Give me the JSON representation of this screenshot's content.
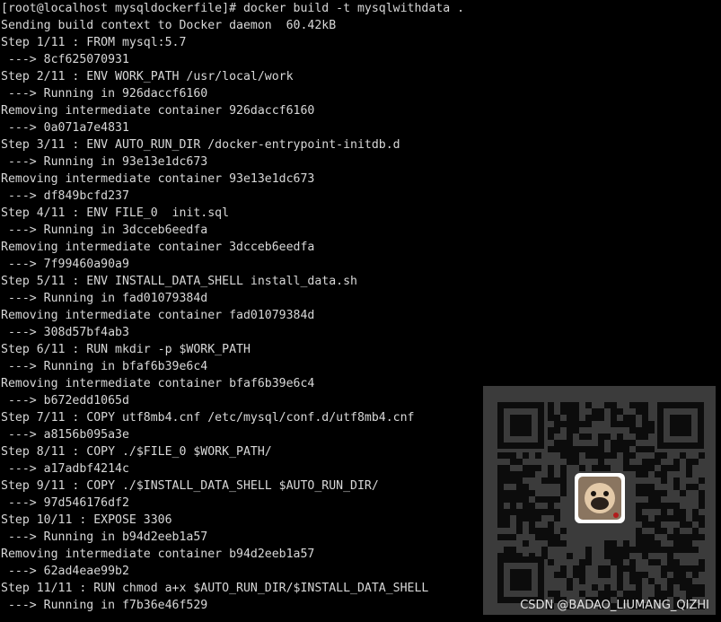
{
  "terminal": {
    "lines": [
      "[root@localhost mysqldockerfile]# docker build -t mysqlwithdata .",
      "Sending build context to Docker daemon  60.42kB",
      "Step 1/11 : FROM mysql:5.7",
      " ---> 8cf625070931",
      "Step 2/11 : ENV WORK_PATH /usr/local/work",
      " ---> Running in 926daccf6160",
      "Removing intermediate container 926daccf6160",
      " ---> 0a071a7e4831",
      "Step 3/11 : ENV AUTO_RUN_DIR /docker-entrypoint-initdb.d",
      " ---> Running in 93e13e1dc673",
      "Removing intermediate container 93e13e1dc673",
      " ---> df849bcfd237",
      "Step 4/11 : ENV FILE_0  init.sql",
      " ---> Running in 3dcceb6eedfa",
      "Removing intermediate container 3dcceb6eedfa",
      " ---> 7f99460a90a9",
      "Step 5/11 : ENV INSTALL_DATA_SHELL install_data.sh",
      " ---> Running in fad01079384d",
      "Removing intermediate container fad01079384d",
      " ---> 308d57bf4ab3",
      "Step 6/11 : RUN mkdir -p $WORK_PATH",
      " ---> Running in bfaf6b39e6c4",
      "Removing intermediate container bfaf6b39e6c4",
      " ---> b672edd1065d",
      "Step 7/11 : COPY utf8mb4.cnf /etc/mysql/conf.d/utf8mb4.cnf",
      " ---> a8156b095a3e",
      "Step 8/11 : COPY ./$FILE_0 $WORK_PATH/",
      " ---> a17adbf4214c",
      "Step 9/11 : COPY ./$INSTALL_DATA_SHELL $AUTO_RUN_DIR/",
      " ---> 97d546176df2",
      "Step 10/11 : EXPOSE 3306",
      " ---> Running in b94d2eeb1a57",
      "Removing intermediate container b94d2eeb1a57",
      " ---> 62ad4eae99b2",
      "Step 11/11 : RUN chmod a+x $AUTO_RUN_DIR/$INSTALL_DATA_SHELL",
      " ---> Running in f7b36e46f529"
    ],
    "text_color": "#d8d8d8",
    "background": "#000000"
  },
  "overlay": {
    "qr_icon": "qr-code-with-pug-avatar",
    "watermark": "CSDN @BADAO_LIUMANG_QIZHI"
  }
}
